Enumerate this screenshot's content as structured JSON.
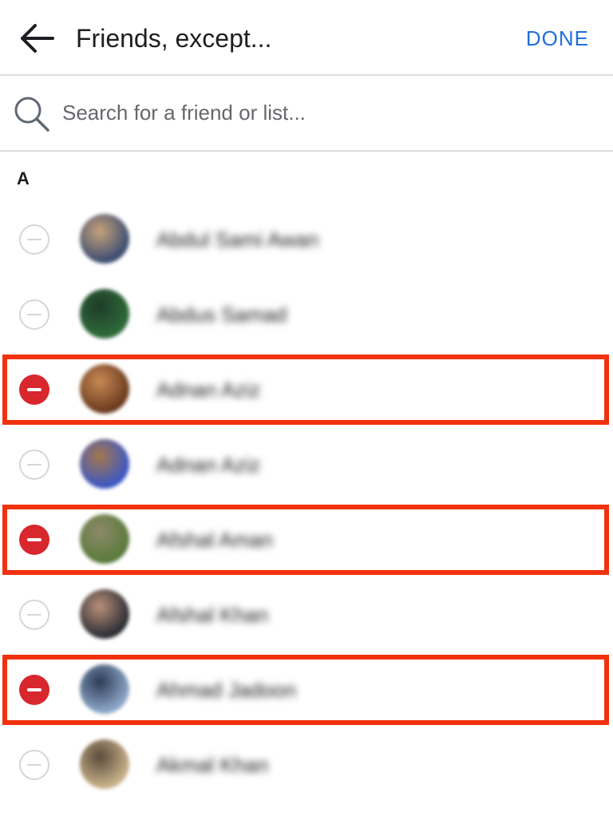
{
  "header": {
    "title": "Friends, except...",
    "done_label": "DONE",
    "back_icon": "arrow-left-icon"
  },
  "search": {
    "placeholder": "Search for a friend or list...",
    "value": "",
    "icon": "search-icon"
  },
  "section": {
    "letter": "A"
  },
  "friends": [
    {
      "name": "Abdul Sami Awan",
      "excluded": false,
      "avatar_colors": [
        "#3b4d72",
        "#c7a27a"
      ]
    },
    {
      "name": "Abdus Samad",
      "excluded": false,
      "avatar_colors": [
        "#2f6b3a",
        "#1e3b28"
      ]
    },
    {
      "name": "Adnan Aziz",
      "excluded": true,
      "avatar_colors": [
        "#6a3a1e",
        "#c98a55"
      ]
    },
    {
      "name": "Adnan Aziz",
      "excluded": false,
      "avatar_colors": [
        "#3b57c4",
        "#a6784c"
      ]
    },
    {
      "name": "Afshal Aman",
      "excluded": true,
      "avatar_colors": [
        "#5a7a3a",
        "#8d8a6a"
      ]
    },
    {
      "name": "Afshal Khan",
      "excluded": false,
      "avatar_colors": [
        "#2b2d33",
        "#b9907a"
      ]
    },
    {
      "name": "Ahmad Jadoon",
      "excluded": true,
      "avatar_colors": [
        "#8fa8c9",
        "#2b3b55"
      ]
    },
    {
      "name": "Akmal Khan",
      "excluded": false,
      "avatar_colors": [
        "#c9b28a",
        "#5a4a3a"
      ]
    }
  ],
  "colors": {
    "accent": "#216fdb",
    "excluded": "#d9272e",
    "highlight": "#f1320e",
    "divider": "#dadde1"
  }
}
